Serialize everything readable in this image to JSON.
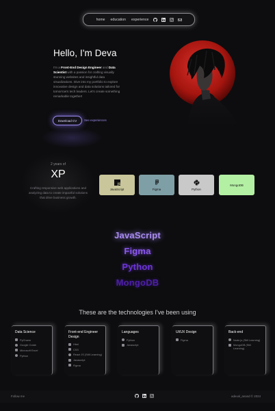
{
  "nav": {
    "links": [
      "home",
      "education",
      "experience"
    ],
    "icons": [
      "github-icon",
      "linkedin-icon",
      "instagram-icon",
      "mail-icon"
    ]
  },
  "hero": {
    "title": "Hello, I'm Deva",
    "intro_pre": "I'm a ",
    "role1": "Front-End Design Engineer",
    "intro_and": " and ",
    "role2": "Data Scientist",
    "intro_post": " with a passion for crafting visually stunning websites and insightful data visualizations. Dive into my portfolio to explore innovative design and data solutions tailored for tomorrow's tech leaders. Let's create something remarkable together!",
    "cv_button": "Download CV",
    "experience_link": "See experiences"
  },
  "xp": {
    "years": "2 years of",
    "label": "XP",
    "description": "Crafting responsive web applications and analyzing data to create impactful solutions that drive business growth."
  },
  "skill_cards": [
    {
      "label": "JavaScript",
      "icon": "javascript-icon",
      "color": "#c8c69a"
    },
    {
      "label": "Figma",
      "icon": "figma-icon",
      "color": "#7f9fa6"
    },
    {
      "label": "Python",
      "icon": "python-icon",
      "color": "#c9c9c9"
    },
    {
      "label": "MongoDB",
      "icon": "mongodb-icon",
      "color": "#b4f0a4"
    }
  ],
  "tech_words": [
    "JavaScript",
    "Figma",
    "Python",
    "MongoDB"
  ],
  "tech_heading": "These are the technologies I've been using",
  "tech_cards": [
    {
      "title": "Data Science",
      "items": [
        "PyCharm",
        "Google Colab",
        "Microsoft Excel",
        "Python"
      ]
    },
    {
      "title": "Front-end Engineer Design",
      "items": [
        "Html",
        "CSS",
        "React JS (Still Learning)",
        "Javascript",
        "Figma"
      ]
    },
    {
      "title": "Languages",
      "items": [
        "Python",
        "Javascript"
      ]
    },
    {
      "title": "UI/UX Design",
      "items": [
        "Figma"
      ]
    },
    {
      "title": "Back-end",
      "items": [
        "Node.js (Still Learning)",
        "MongoDB (Still Learning)"
      ]
    }
  ],
  "footer": {
    "follow": "Follow me",
    "icons": [
      "github-icon",
      "linkedin-icon",
      "instagram-icon"
    ],
    "copyright": "adeval_anand © 2024"
  },
  "colors": {
    "background": "#0d0d0f",
    "accent": "#9d8cf0",
    "hero_circle": "#c0221c"
  }
}
